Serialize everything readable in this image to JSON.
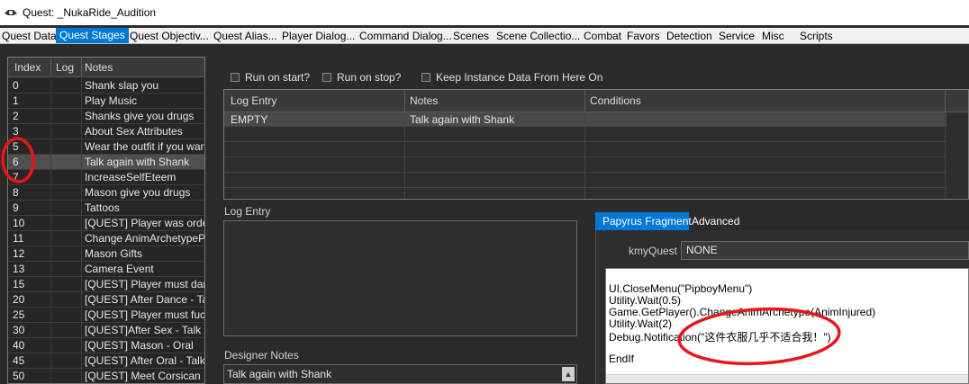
{
  "window": {
    "title": "Quest: _NukaRide_Audition"
  },
  "tabs": [
    {
      "label": "Quest Data",
      "active": false
    },
    {
      "label": "Quest Stages",
      "active": true
    },
    {
      "label": "Quest Objectiv...",
      "active": false
    },
    {
      "label": "Quest Alias...",
      "active": false
    },
    {
      "label": "Player Dialog...",
      "active": false
    },
    {
      "label": "Command Dialog...",
      "active": false
    },
    {
      "label": "Scenes",
      "active": false
    },
    {
      "label": "Scene Collectio...",
      "active": false
    },
    {
      "label": "Combat",
      "active": false
    },
    {
      "label": "Favors",
      "active": false
    },
    {
      "label": "Detection",
      "active": false
    },
    {
      "label": "Service",
      "active": false
    },
    {
      "label": "Misc",
      "active": false
    },
    {
      "label": "Scripts",
      "active": false
    }
  ],
  "stages": {
    "columns": {
      "index": "Index",
      "log": "Log",
      "notes": "Notes"
    },
    "rows": [
      {
        "index": "0",
        "log": "",
        "notes": "Shank slap you",
        "selected": false
      },
      {
        "index": "1",
        "log": "",
        "notes": "Play Music",
        "selected": false
      },
      {
        "index": "2",
        "log": "",
        "notes": "Shanks give you drugs",
        "selected": false
      },
      {
        "index": "3",
        "log": "",
        "notes": "About Sex Attributes",
        "selected": false
      },
      {
        "index": "5",
        "log": "",
        "notes": "Wear the outfit if you want to",
        "selected": false
      },
      {
        "index": "6",
        "log": "",
        "notes": "Talk again with Shank",
        "selected": true
      },
      {
        "index": "7",
        "log": "",
        "notes": "IncreaseSelfEteem",
        "selected": false
      },
      {
        "index": "8",
        "log": "",
        "notes": "Mason give you drugs",
        "selected": false
      },
      {
        "index": "9",
        "log": "",
        "notes": "Tattoos",
        "selected": false
      },
      {
        "index": "10",
        "log": "",
        "notes": "[QUEST] Player was ordered",
        "selected": false
      },
      {
        "index": "11",
        "log": "",
        "notes": "Change AnimArchetypePlayer",
        "selected": false
      },
      {
        "index": "12",
        "log": "",
        "notes": "Mason Gifts",
        "selected": false
      },
      {
        "index": "13",
        "log": "",
        "notes": "Camera Event",
        "selected": false
      },
      {
        "index": "15",
        "log": "",
        "notes": "[QUEST] Player must dance",
        "selected": false
      },
      {
        "index": "20",
        "log": "",
        "notes": "[QUEST] After Dance - Talk",
        "selected": false
      },
      {
        "index": "25",
        "log": "",
        "notes": "[QUEST] Player must fuck",
        "selected": false
      },
      {
        "index": "30",
        "log": "",
        "notes": "[QUEST]After Sex - Talk Mason",
        "selected": false
      },
      {
        "index": "40",
        "log": "",
        "notes": "[QUEST] Mason - Oral",
        "selected": false
      },
      {
        "index": "45",
        "log": "",
        "notes": "[QUEST] After Oral - Talk Mason",
        "selected": false
      },
      {
        "index": "50",
        "log": "",
        "notes": "[QUEST] Meet Corsican",
        "selected": false
      }
    ]
  },
  "options": {
    "run_on_start": "Run on start?",
    "run_on_stop": "Run on stop?",
    "keep_instance": "Keep Instance Data From Here On"
  },
  "log_table": {
    "columns": {
      "log_entry": "Log Entry",
      "notes": "Notes",
      "conditions": "Conditions"
    },
    "rows": [
      {
        "log_entry": "EMPTY",
        "notes": "Talk again with Shank",
        "conditions": ""
      }
    ]
  },
  "log_entry_label": "Log Entry",
  "designer_notes": {
    "label": "Designer Notes",
    "value": "Talk again with Shank"
  },
  "fragment": {
    "tabs": [
      "Papyrus Fragment",
      "Advanced"
    ],
    "kmy_label": "kmyQuest",
    "kmy_value": "NONE",
    "code": [
      "UI.CloseMenu(\"PipboyMenu\")",
      "Utility.Wait(0.5)",
      "Game.GetPlayer().ChangeAnimArchetype(AnimInjured)",
      "Utility.Wait(2)",
      "Debug.Notification(\"这件衣服几乎不适合我！\")",
      "",
      "EndIf"
    ]
  },
  "colors": {
    "accent": "#0078d7",
    "annotation": "#e8151b",
    "panel_bg": "#2b2b2b"
  }
}
